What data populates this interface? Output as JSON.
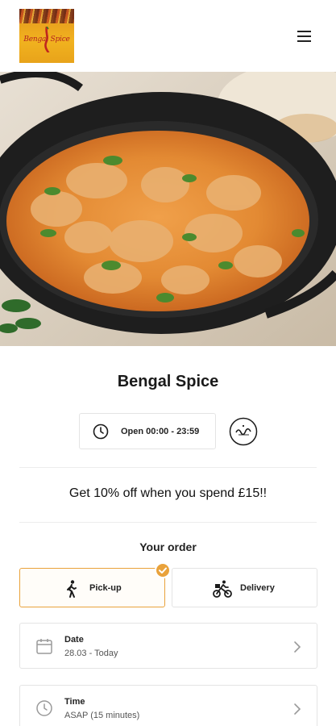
{
  "header": {
    "logo_text": "Bengal Spice",
    "menu_icon": "hamburger-menu-icon"
  },
  "hero": {
    "icon": "curry-dish-photo"
  },
  "restaurant": {
    "name": "Bengal Spice",
    "hours": "Open 00:00 - 23:59",
    "halal_icon": "halal-badge-icon"
  },
  "promo": {
    "text": "Get 10% off when you spend £15!!"
  },
  "order": {
    "heading": "Your order",
    "options": [
      {
        "label": "Pick-up",
        "icon": "walking-person-icon",
        "selected": true
      },
      {
        "label": "Delivery",
        "icon": "cyclist-icon",
        "selected": false
      }
    ],
    "date": {
      "label": "Date",
      "value": "28.03 - Today"
    },
    "time": {
      "label": "Time",
      "value": "ASAP (15 minutes)"
    }
  },
  "colors": {
    "accent": "#e9a23b",
    "border": "#e4e4e4",
    "text": "#1a1a1a"
  }
}
